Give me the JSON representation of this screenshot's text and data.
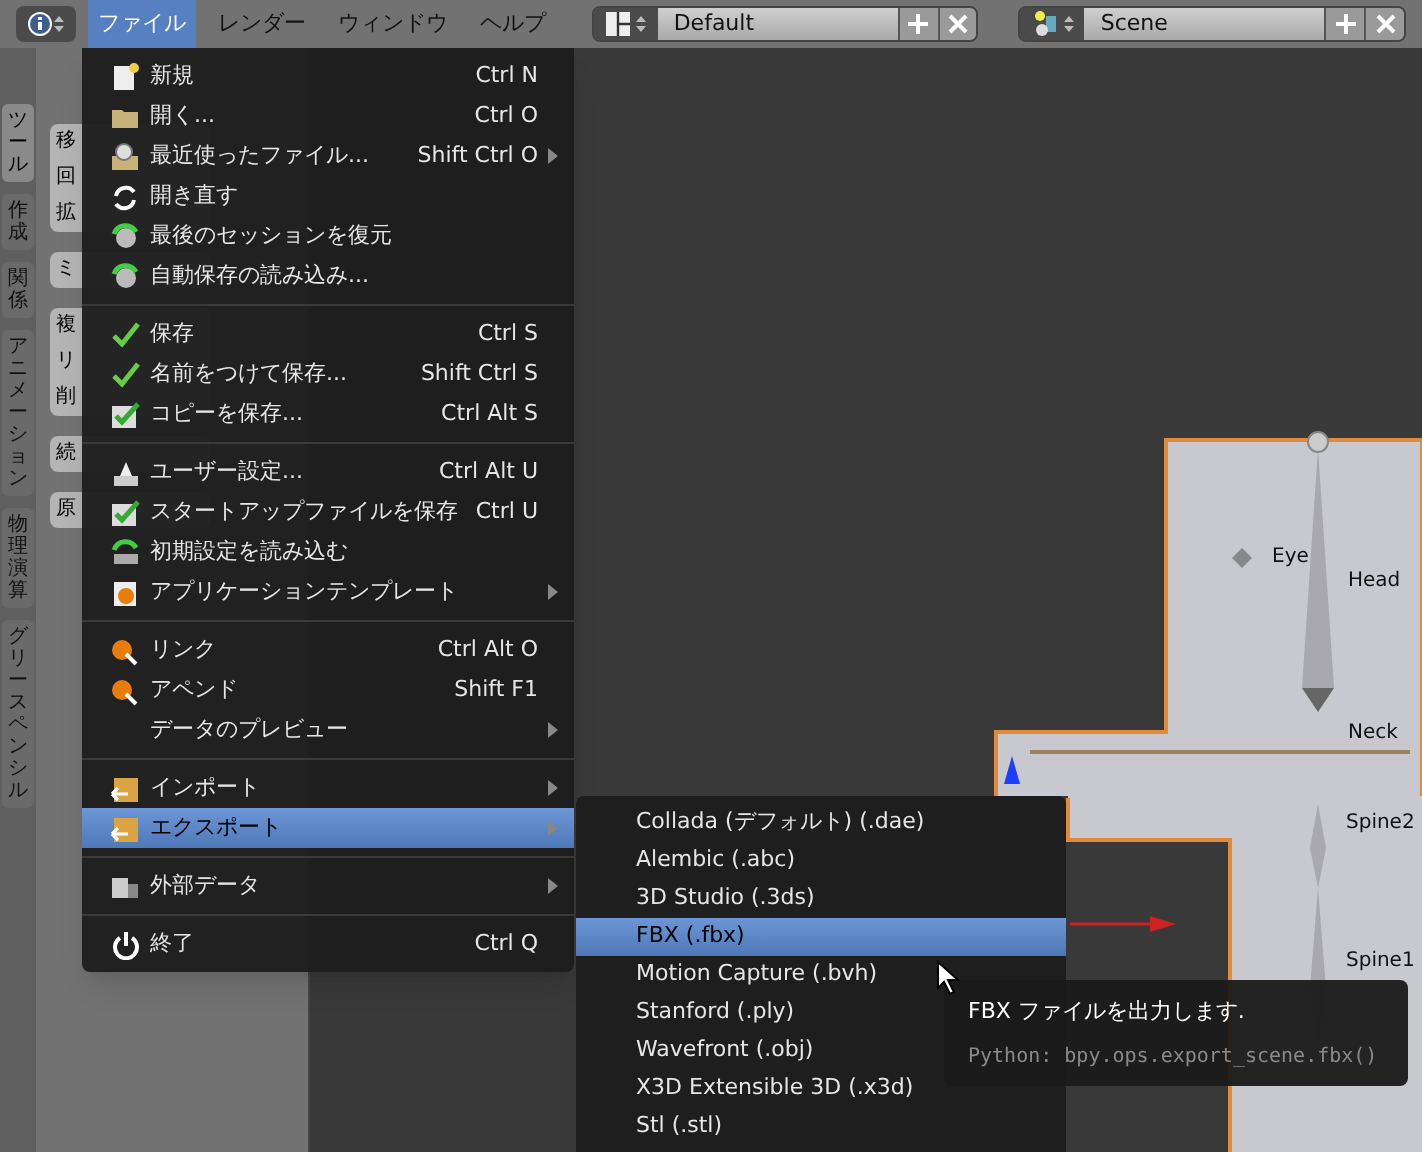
{
  "top_bar": {
    "menus": [
      {
        "label": "ファイル",
        "selected": true
      },
      {
        "label": "レンダー",
        "selected": false
      },
      {
        "label": "ウィンドウ",
        "selected": false
      },
      {
        "label": "ヘルプ",
        "selected": false
      }
    ],
    "layout": {
      "value": "Default"
    },
    "scene": {
      "value": "Scene"
    }
  },
  "sidebar": {
    "tabs": [
      {
        "label": "ツール",
        "selected": true
      },
      {
        "label": "作成",
        "selected": false
      },
      {
        "label": "関係",
        "selected": false
      },
      {
        "label": "アニメーション",
        "selected": false
      },
      {
        "label": "物理演算",
        "selected": false
      },
      {
        "label": "グリースペンシル",
        "selected": false
      }
    ],
    "button_groups": [
      [
        "移",
        "回",
        "拡"
      ],
      [
        "ミ"
      ],
      [
        "複",
        "リ",
        "削"
      ],
      [
        "続"
      ],
      [
        "原"
      ]
    ]
  },
  "file_menu": {
    "sections": [
      [
        {
          "label": "新規",
          "shortcut": "Ctrl N",
          "submenu": false,
          "selected": false
        },
        {
          "label": "開く...",
          "shortcut": "Ctrl O",
          "submenu": false,
          "selected": false
        },
        {
          "label": "最近使ったファイル...",
          "shortcut": "Shift Ctrl O",
          "submenu": true,
          "selected": false
        },
        {
          "label": "開き直す",
          "submenu": false,
          "selected": false
        },
        {
          "label": "最後のセッションを復元",
          "submenu": false,
          "selected": false
        },
        {
          "label": "自動保存の読み込み...",
          "submenu": false,
          "selected": false
        }
      ],
      [
        {
          "label": "保存",
          "shortcut": "Ctrl S",
          "submenu": false,
          "selected": false
        },
        {
          "label": "名前をつけて保存...",
          "shortcut": "Shift Ctrl S",
          "submenu": false,
          "selected": false
        },
        {
          "label": "コピーを保存...",
          "shortcut": "Ctrl Alt S",
          "submenu": false,
          "selected": false
        }
      ],
      [
        {
          "label": "ユーザー設定...",
          "shortcut": "Ctrl Alt U",
          "submenu": false,
          "selected": false
        },
        {
          "label": "スタートアップファイルを保存",
          "shortcut": "Ctrl U",
          "submenu": false,
          "selected": false
        },
        {
          "label": "初期設定を読み込む",
          "submenu": false,
          "selected": false
        },
        {
          "label": "アプリケーションテンプレート",
          "submenu": true,
          "selected": false
        }
      ],
      [
        {
          "label": "リンク",
          "shortcut": "Ctrl Alt O",
          "submenu": false,
          "selected": false
        },
        {
          "label": "アペンド",
          "shortcut": "Shift F1",
          "submenu": false,
          "selected": false
        },
        {
          "label": "データのプレビュー",
          "submenu": true,
          "selected": false
        }
      ],
      [
        {
          "label": "インポート",
          "submenu": true,
          "selected": false
        },
        {
          "label": "エクスポート",
          "submenu": true,
          "selected": true
        }
      ],
      [
        {
          "label": "外部データ",
          "submenu": true,
          "selected": false
        }
      ],
      [
        {
          "label": "終了",
          "shortcut": "Ctrl Q",
          "submenu": false,
          "selected": false
        }
      ]
    ]
  },
  "export_menu": {
    "items": [
      {
        "label": "Collada (デフォルト) (.dae)",
        "selected": false
      },
      {
        "label": "Alembic (.abc)",
        "selected": false
      },
      {
        "label": "3D Studio (.3ds)",
        "selected": false
      },
      {
        "label": "FBX (.fbx)",
        "selected": true
      },
      {
        "label": "Motion Capture (.bvh)",
        "selected": false
      },
      {
        "label": "Stanford (.ply)",
        "selected": false
      },
      {
        "label": "Wavefront (.obj)",
        "selected": false
      },
      {
        "label": "X3D Extensible 3D (.x3d)",
        "selected": false
      },
      {
        "label": "Stl (.stl)",
        "selected": false
      }
    ]
  },
  "tooltip": {
    "title": "FBX ファイルを出力します.",
    "python": "Python: bpy.ops.export_scene.fbx()"
  },
  "viewport": {
    "bone_labels": [
      {
        "label": "Eye"
      },
      {
        "label": "Head"
      },
      {
        "label": "Neck"
      },
      {
        "label": "Spine2"
      },
      {
        "label": "Spine1"
      }
    ]
  }
}
